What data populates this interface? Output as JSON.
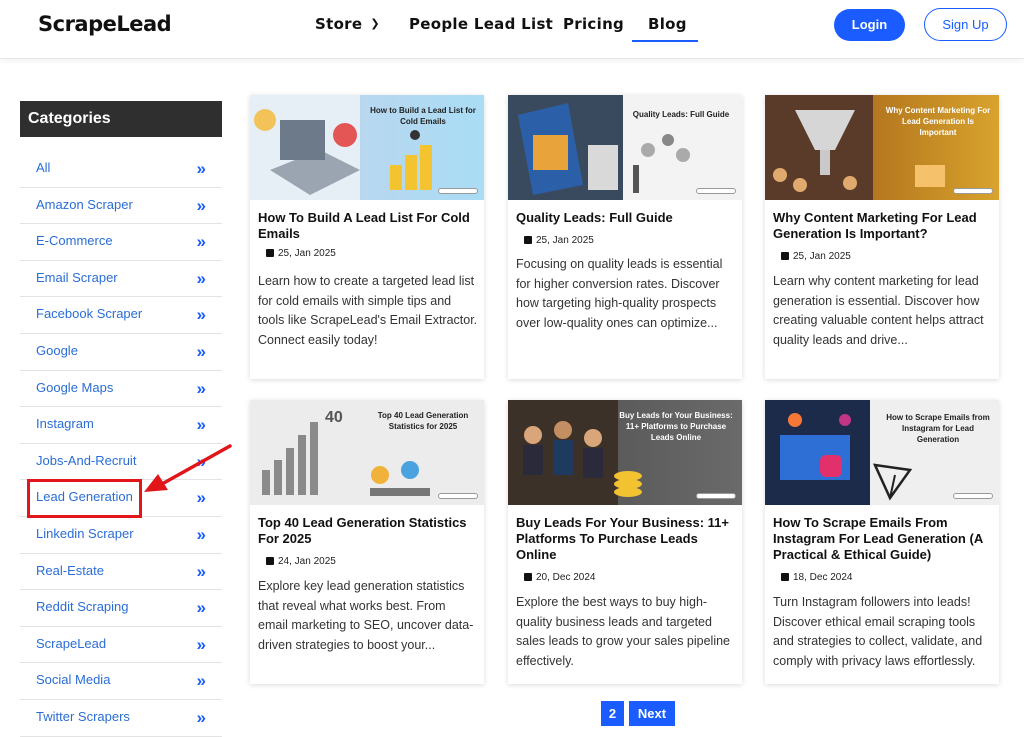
{
  "header": {
    "logo": "ScrapeLead",
    "nav": [
      "Store",
      "People Lead List",
      "Pricing",
      "Blog"
    ],
    "login": "Login",
    "signup": "Sign Up"
  },
  "sidebar": {
    "title": "Categories",
    "items": [
      "All",
      "Amazon Scraper",
      "E-Commerce",
      "Email Scraper",
      "Facebook Scraper",
      "Google",
      "Google Maps",
      "Instagram",
      "Jobs-And-Recruit",
      "Lead Generation",
      "Linkedin Scraper",
      "Real-Estate",
      "Reddit Scraping",
      "ScrapeLead",
      "Social Media",
      "Twitter Scrapers"
    ],
    "highlighted": "Lead Generation"
  },
  "posts": [
    {
      "thumb_title": "How to Build a Lead List for Cold Emails",
      "title": "How To Build A Lead List For Cold Emails",
      "date": "25, Jan 2025",
      "desc": "Learn how to create a targeted lead list for cold emails with simple tips and tools like ScrapeLead's Email Extractor. Connect easily today!"
    },
    {
      "thumb_title": "Quality Leads: Full Guide",
      "title": "Quality Leads: Full Guide",
      "date": "25, Jan 2025",
      "desc": "Focusing on quality leads is essential for higher conversion rates. Discover how targeting high-quality prospects over low-quality ones can optimize..."
    },
    {
      "thumb_title": "Why Content Marketing For Lead Generation Is Important",
      "title": "Why Content Marketing For Lead Generation Is Important?",
      "date": "25, Jan 2025",
      "desc": "Learn why content marketing for lead generation is essential. Discover how creating valuable content helps attract quality leads and drive..."
    },
    {
      "thumb_title": "Top 40 Lead Generation Statistics for 2025",
      "title": "Top 40 Lead Generation Statistics For 2025",
      "date": "24, Jan 2025",
      "desc": "Explore key lead generation statistics that reveal what works best. From email marketing to SEO, uncover data-driven strategies to boost your..."
    },
    {
      "thumb_title": "Buy Leads for Your Business: 11+ Platforms to Purchase Leads Online",
      "title": "Buy Leads For Your Business: 11+ Platforms To Purchase Leads Online",
      "date": "20, Dec 2024",
      "desc": "Explore the best ways to buy high-quality business leads and targeted sales leads to grow your sales pipeline effectively."
    },
    {
      "thumb_title": "How to Scrape Emails from Instagram for Lead Generation",
      "title": "How To Scrape Emails From Instagram For Lead Generation (A Practical & Ethical Guide)",
      "date": "18, Dec 2024",
      "desc": "Turn Instagram followers into leads! Discover ethical email scraping tools and strategies to collect, validate, and comply with privacy laws effortlessly."
    }
  ],
  "pagination": {
    "page": "2",
    "next": "Next"
  },
  "colors": {
    "accent": "#1a5cff",
    "highlight": "#e0161a",
    "sidebar_header": "#2f2f2f"
  },
  "icons": {
    "nav_dropdown": "chevron-down-icon",
    "category": "double-chevron-right-icon",
    "date": "calendar-icon"
  }
}
